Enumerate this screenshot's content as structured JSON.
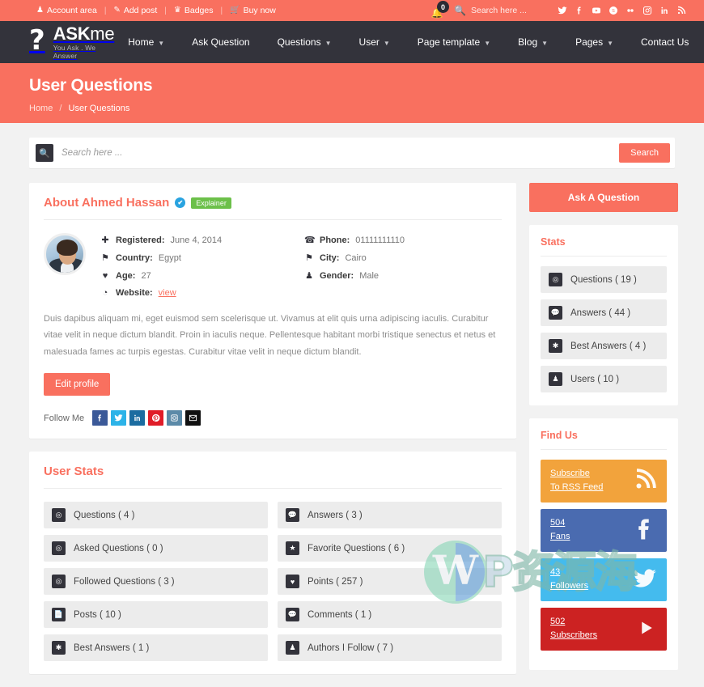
{
  "colors": {
    "accent": "#f9705f",
    "dark": "#33333b",
    "verified": "#29a3e0",
    "badge_green": "#6cc04a",
    "rss_orange": "#f2a33c",
    "facebook_blue": "#4a6bb0",
    "twitter_blue": "#44bbee",
    "youtube_red": "#cc2222"
  },
  "topbar": {
    "links": [
      {
        "label": "Account area",
        "icon": "user-icon",
        "glyph": "A"
      },
      {
        "label": "Add post",
        "icon": "pencil-icon",
        "glyph": "✎"
      },
      {
        "label": "Badges",
        "icon": "trophy-icon",
        "glyph": "♛"
      },
      {
        "label": "Buy now",
        "icon": "cart-icon",
        "glyph": "☰"
      }
    ],
    "separator": "|",
    "notification_count": "0",
    "notification_icon": "bell-icon",
    "search_icon": "search-icon",
    "search_placeholder": "Search here ...",
    "socials": [
      {
        "name": "twitter-icon",
        "label": "Twitter"
      },
      {
        "name": "facebook-icon",
        "label": "Facebook"
      },
      {
        "name": "youtube-icon",
        "label": "YouTube"
      },
      {
        "name": "skype-icon",
        "label": "Skype"
      },
      {
        "name": "flickr-icon",
        "label": "Flickr"
      },
      {
        "name": "instagram-icon",
        "label": "Instagram"
      },
      {
        "name": "linkedin-icon",
        "label": "LinkedIn"
      },
      {
        "name": "rss-icon",
        "label": "RSS"
      }
    ]
  },
  "header": {
    "logo_mark": "?",
    "logo_name_bold": "ASK",
    "logo_name_thin": "me",
    "logo_tagline": "You Ask . We Answer",
    "nav": [
      {
        "label": "Home",
        "has_caret": true
      },
      {
        "label": "Ask Question",
        "has_caret": false
      },
      {
        "label": "Questions",
        "has_caret": true
      },
      {
        "label": "User",
        "has_caret": true
      },
      {
        "label": "Page template",
        "has_caret": true
      },
      {
        "label": "Blog",
        "has_caret": true
      },
      {
        "label": "Pages",
        "has_caret": true
      },
      {
        "label": "Contact Us",
        "has_caret": false
      }
    ]
  },
  "banner": {
    "title": "User Questions",
    "crumb_home": "Home",
    "crumb_sep": "/",
    "crumb_current": "User Questions"
  },
  "search": {
    "placeholder": "Search here ...",
    "value": "",
    "button_label": "Search"
  },
  "profile": {
    "title": "About Ahmed Hassan",
    "verified_glyph": "✔",
    "badge": "Explainer",
    "avatar_alt": "Ahmed Hassan avatar",
    "info": [
      {
        "icon": "plus-icon",
        "glyph": "✚",
        "label": "Registered:",
        "value": "June 4, 2014",
        "link": false
      },
      {
        "icon": "phone-icon",
        "glyph": "☎",
        "label": "Phone:",
        "value": "01111111110",
        "link": false
      },
      {
        "icon": "map-pin-icon",
        "glyph": "⚑",
        "label": "Country:",
        "value": "Egypt",
        "link": false
      },
      {
        "icon": "map-pin-icon",
        "glyph": "⚑",
        "label": "City:",
        "value": "Cairo",
        "link": false
      },
      {
        "icon": "heart-icon",
        "glyph": "♥",
        "label": "Age:",
        "value": "27",
        "link": false
      },
      {
        "icon": "person-icon",
        "glyph": "♟",
        "label": "Gender:",
        "value": "Male",
        "link": false
      },
      {
        "icon": "globe-icon",
        "glyph": "◔",
        "label": "Website:",
        "value": "view",
        "link": true
      }
    ],
    "bio": "Duis dapibus aliquam mi, eget euismod sem scelerisque ut. Vivamus at elit quis urna adipiscing iaculis. Curabitur vitae velit in neque dictum blandit. Proin in iaculis neque. Pellentesque habitant morbi tristique senectus et netus et malesuada fames ac turpis egestas. Curabitur vitae velit in neque dictum blandit.",
    "edit_label": "Edit profile",
    "follow_label": "Follow Me",
    "follow_icons": [
      {
        "name": "facebook-icon",
        "color": "#3b5998"
      },
      {
        "name": "twitter-icon",
        "color": "#2cb3e8"
      },
      {
        "name": "linkedin-icon",
        "color": "#1b6ca0"
      },
      {
        "name": "pinterest-icon",
        "color": "#e01c28"
      },
      {
        "name": "instagram-icon",
        "color": "#5b8aa8"
      },
      {
        "name": "email-icon",
        "color": "#101010"
      }
    ]
  },
  "user_stats": {
    "title": "User Stats",
    "rows": [
      {
        "icon": "clock-question-icon",
        "label": "Questions ( 4 )"
      },
      {
        "icon": "comment-icon",
        "label": "Answers ( 3 )"
      },
      {
        "icon": "clock-question-icon",
        "label": "Asked Questions ( 0 )"
      },
      {
        "icon": "star-icon",
        "label": "Favorite Questions ( 6 )"
      },
      {
        "icon": "clock-question-icon",
        "label": "Followed Questions ( 3 )"
      },
      {
        "icon": "heart-icon",
        "label": "Points ( 257 )"
      },
      {
        "icon": "file-icon",
        "label": "Posts ( 10 )"
      },
      {
        "icon": "comment-icon",
        "label": "Comments ( 1 )"
      },
      {
        "icon": "asterisk-icon",
        "label": "Best Answers ( 1 )"
      },
      {
        "icon": "user-icon",
        "label": "Authors I Follow ( 7 )"
      }
    ]
  },
  "sidebar": {
    "ask_button": "Ask A Question",
    "stats_title": "Stats",
    "stats": [
      {
        "icon": "clock-question-icon",
        "label": "Questions ( 19 )"
      },
      {
        "icon": "comment-icon",
        "label": "Answers ( 44 )"
      },
      {
        "icon": "asterisk-icon",
        "label": "Best Answers ( 4 )"
      },
      {
        "icon": "user-icon",
        "label": "Users ( 10 )"
      }
    ],
    "find_title": "Find Us",
    "find_tiles": [
      {
        "icon": "rss-icon",
        "line1": "Subscribe",
        "line2": "To RSS Feed",
        "color": "#f2a33c"
      },
      {
        "icon": "facebook-icon",
        "line1": "504",
        "line2": "Fans",
        "color": "#4a6bb0"
      },
      {
        "icon": "twitter-icon",
        "line1": "43",
        "line2": "Followers",
        "color": "#44bbee"
      },
      {
        "icon": "youtube-icon",
        "line1": "502",
        "line2": "Subscribers",
        "color": "#cc2222"
      }
    ]
  },
  "watermark": {
    "text": "P资源海"
  }
}
